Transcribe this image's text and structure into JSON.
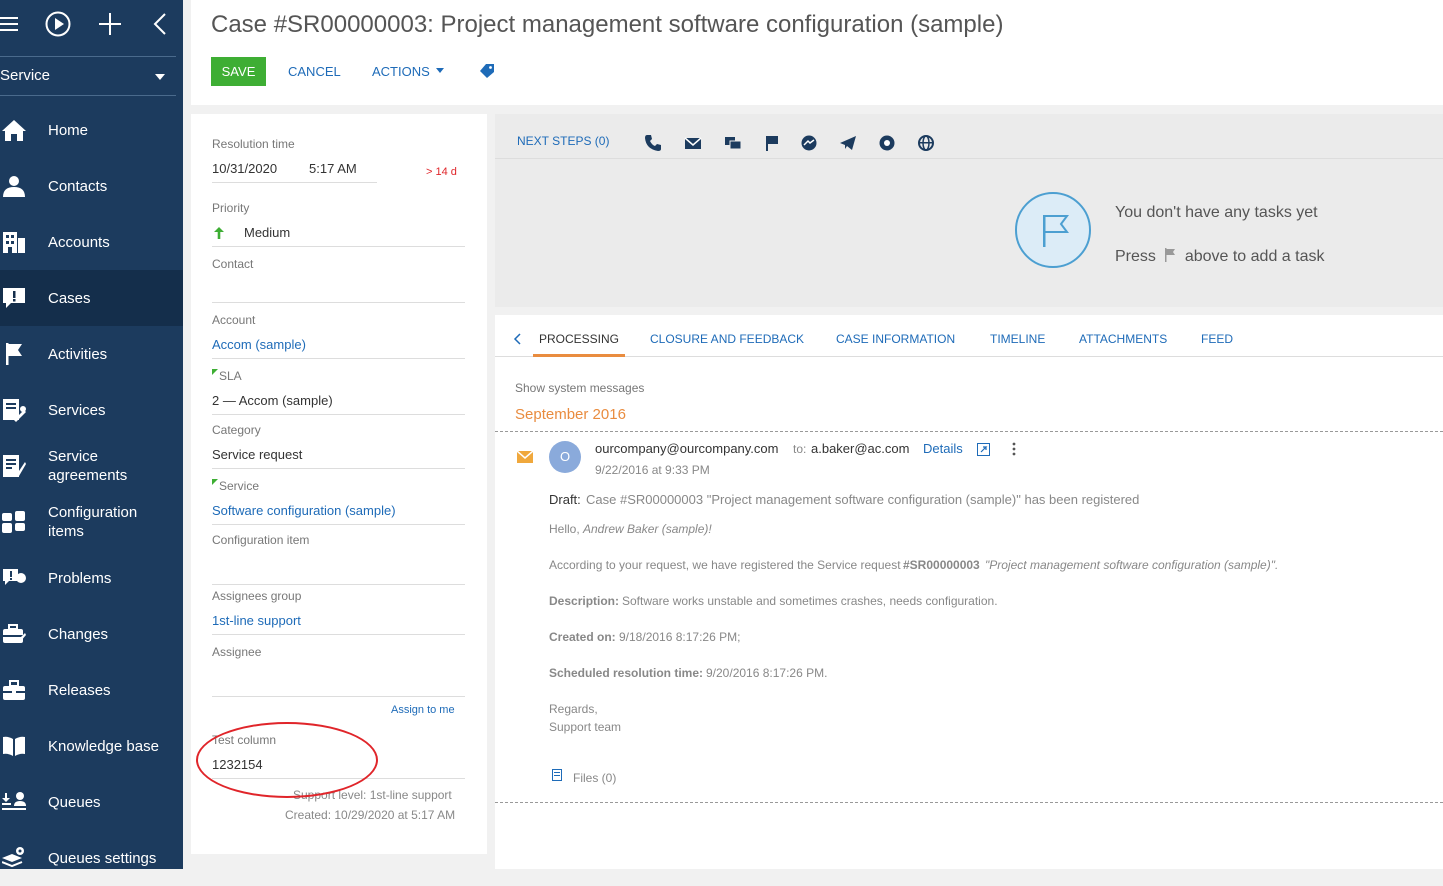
{
  "sidebar": {
    "top_icons": [
      "menu-icon",
      "play-circle-icon",
      "plus-icon",
      "chevron-left-icon"
    ],
    "section": "Service",
    "items": [
      {
        "label": "Home",
        "icon": "home-icon"
      },
      {
        "label": "Contacts",
        "icon": "person-icon"
      },
      {
        "label": "Accounts",
        "icon": "building-icon"
      },
      {
        "label": "Cases",
        "icon": "exclamation-bubble-icon"
      },
      {
        "label": "Activities",
        "icon": "flag-icon"
      },
      {
        "label": "Services",
        "icon": "wrench-doc-icon"
      },
      {
        "label": "Service agreements",
        "icon": "pen-doc-icon"
      },
      {
        "label": "Configuration items",
        "icon": "grid-icon"
      },
      {
        "label": "Problems",
        "icon": "problem-icon"
      },
      {
        "label": "Changes",
        "icon": "briefcase-icon"
      },
      {
        "label": "Releases",
        "icon": "box-icon"
      },
      {
        "label": "Knowledge base",
        "icon": "book-icon"
      },
      {
        "label": "Queues",
        "icon": "queue-icon"
      },
      {
        "label": "Queues settings",
        "icon": "settings-stack-icon"
      }
    ]
  },
  "header": {
    "title": "Case #SR00000003: Project management software configuration (sample)",
    "save": "SAVE",
    "cancel": "CANCEL",
    "actions": "ACTIONS"
  },
  "fields": {
    "resolution_time": {
      "label": "Resolution time",
      "date": "10/31/2020",
      "time": "5:17 AM",
      "overdue": "> 14 d"
    },
    "priority": {
      "label": "Priority",
      "value": "Medium"
    },
    "contact": {
      "label": "Contact",
      "value": ""
    },
    "account": {
      "label": "Account",
      "value": "Accom (sample)"
    },
    "sla": {
      "label": "SLA",
      "value": "2 — Accom (sample)"
    },
    "category": {
      "label": "Category",
      "value": "Service request"
    },
    "service": {
      "label": "Service",
      "value": "Software configuration (sample)"
    },
    "config_item": {
      "label": "Configuration item",
      "value": ""
    },
    "assignees_group": {
      "label": "Assignees group",
      "value": "1st-line support"
    },
    "assignee": {
      "label": "Assignee",
      "value": ""
    },
    "assign_to_me": "Assign to me",
    "test_column": {
      "label": "Test column",
      "value": "1232154"
    },
    "support_level": "Support level: 1st-line support",
    "created": "Created: 10/29/2020 at 5:17 AM"
  },
  "next_steps": {
    "label": "NEXT STEPS (0)",
    "channels": [
      "call-icon",
      "email-icon",
      "chat-icon",
      "flag-icon",
      "messenger-icon",
      "telegram-icon",
      "whatsapp-icon",
      "globe-icon"
    ],
    "empty_1": "You don't have any tasks yet",
    "empty_2_pre": "Press",
    "empty_2_post": "above to add a task"
  },
  "tabs": [
    "PROCESSING",
    "CLOSURE AND FEEDBACK",
    "CASE INFORMATION",
    "TIMELINE",
    "ATTACHMENTS",
    "FEED"
  ],
  "feed": {
    "show_system": "Show system messages",
    "month": "September 2016",
    "avatar": "O",
    "from": "ourcompany@ourcompany.com",
    "to_label": "to:",
    "to": "a.baker@ac.com",
    "details": "Details",
    "date": "9/22/2016 at 9:33 PM",
    "draft_label": "Draft:",
    "draft": "Case #SR00000003 \"Project management software configuration (sample)\" has been registered",
    "hello": "Hello,",
    "hello_name": "Andrew Baker (sample)!",
    "line1": "According to your request, we have registered the Service request",
    "line1_num": "#SR00000003",
    "line1_name": "\"Project management software configuration (sample)\".",
    "desc_label": "Description:",
    "desc": "Software works unstable and sometimes crashes, needs configuration.",
    "created_label": "Created on:",
    "created": "9/18/2016 8:17:26 PM;",
    "sched_label": "Scheduled resolution time:",
    "sched": "9/20/2016 8:17:26 PM.",
    "regards": "Regards,",
    "team": "Support team",
    "files": "Files (0)"
  },
  "colors": {
    "sidebar": "#1c3b5e",
    "accent": "#3eae34",
    "link": "#1e6bb8",
    "orange": "#e98c3f",
    "annotation": "#e0252a"
  }
}
